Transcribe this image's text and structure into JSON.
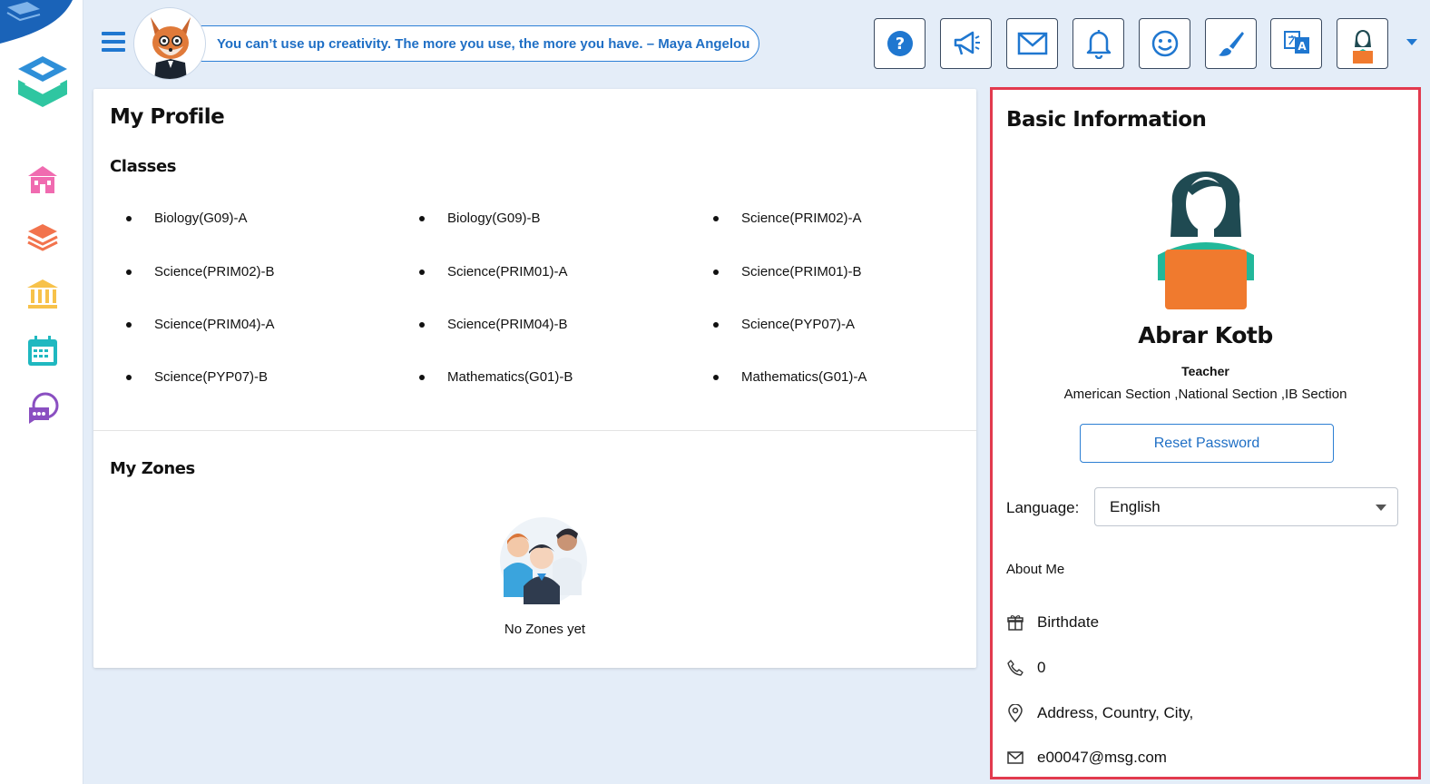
{
  "header": {
    "quote": "You can’t use up creativity. The more you use, the more you have. – Maya Angelou"
  },
  "top_buttons": [
    {
      "icon": "help-icon"
    },
    {
      "icon": "megaphone-icon"
    },
    {
      "icon": "mail-icon"
    },
    {
      "icon": "bell-icon"
    },
    {
      "icon": "smiley-icon"
    },
    {
      "icon": "brush-icon"
    },
    {
      "icon": "translate-icon"
    },
    {
      "icon": "user-avatar-icon"
    }
  ],
  "sidebar": {
    "items": [
      {
        "icon": "school-icon",
        "color": "#f06bb0"
      },
      {
        "icon": "layers-icon",
        "color": "#f2734d"
      },
      {
        "icon": "institution-icon",
        "color": "#f7c24a"
      },
      {
        "icon": "calendar-icon",
        "color": "#1fb8c0"
      },
      {
        "icon": "chat-icon",
        "color": "#8a4fc1"
      }
    ]
  },
  "profile": {
    "title": "My Profile",
    "classes_heading": "Classes",
    "classes": [
      "Biology(G09)-A",
      "Biology(G09)-B",
      "Science(PRIM02)-A",
      "Science(PRIM02)-B",
      "Science(PRIM01)-A",
      "Science(PRIM01)-B",
      "Science(PRIM04)-A",
      "Science(PRIM04)-B",
      "Science(PYP07)-A",
      "Science(PYP07)-B",
      "Mathematics(G01)-B",
      "Mathematics(G01)-A"
    ],
    "zones_heading": "My Zones",
    "no_zones": "No Zones yet"
  },
  "basic_info": {
    "title": "Basic Information",
    "name": "Abrar Kotb",
    "role": "Teacher",
    "sections": "American Section ,National Section ,IB Section",
    "reset_password": "Reset Password",
    "language_label": "Language:",
    "language_value": "English",
    "about_me": "About Me",
    "birthdate": "Birthdate",
    "phone": "0",
    "address": "Address, Country, City,",
    "email": "e00047@msg.com"
  },
  "colors": {
    "accent": "#1f77d0",
    "highlight_border": "#e23a4e",
    "background": "#e4edf8"
  }
}
